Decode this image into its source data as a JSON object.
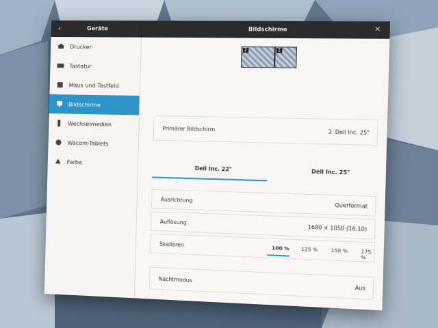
{
  "titlebar": {
    "left_title": "Geräte",
    "main_title": "Bildschirme"
  },
  "sidebar": {
    "items": [
      {
        "label": "Drucker",
        "icon": "printer-icon"
      },
      {
        "label": "Tastatur",
        "icon": "keyboard-icon"
      },
      {
        "label": "Maus und Tastfeld",
        "icon": "mouse-icon"
      },
      {
        "label": "Bildschirme",
        "icon": "display-icon",
        "active": true
      },
      {
        "label": "Wechselmedien",
        "icon": "usb-icon"
      },
      {
        "label": "Wacom-Tablets",
        "icon": "tablet-icon"
      },
      {
        "label": "Farbe",
        "icon": "color-icon"
      }
    ]
  },
  "monitors": {
    "left_number": "2",
    "right_number": "1"
  },
  "primary": {
    "label": "Primärer Bildschirm",
    "number": "2",
    "value": "Dell Inc. 25\""
  },
  "tabs": [
    "Dell Inc. 22\"",
    "Dell Inc. 25\""
  ],
  "settings": {
    "orientation_label": "Ausrichtung",
    "orientation_value": "Querformat",
    "resolution_label": "Auflösung",
    "resolution_value": "1680 × 1050 (16:10)",
    "scale_label": "Skalieren",
    "scale_options": [
      "100 %",
      "125 %",
      "150 %",
      "175 %"
    ],
    "night_label": "Nachtmodus",
    "night_value": "Aus"
  },
  "colors": {
    "accent": "#2e94c7",
    "titlebar": "#2b2b2b"
  }
}
